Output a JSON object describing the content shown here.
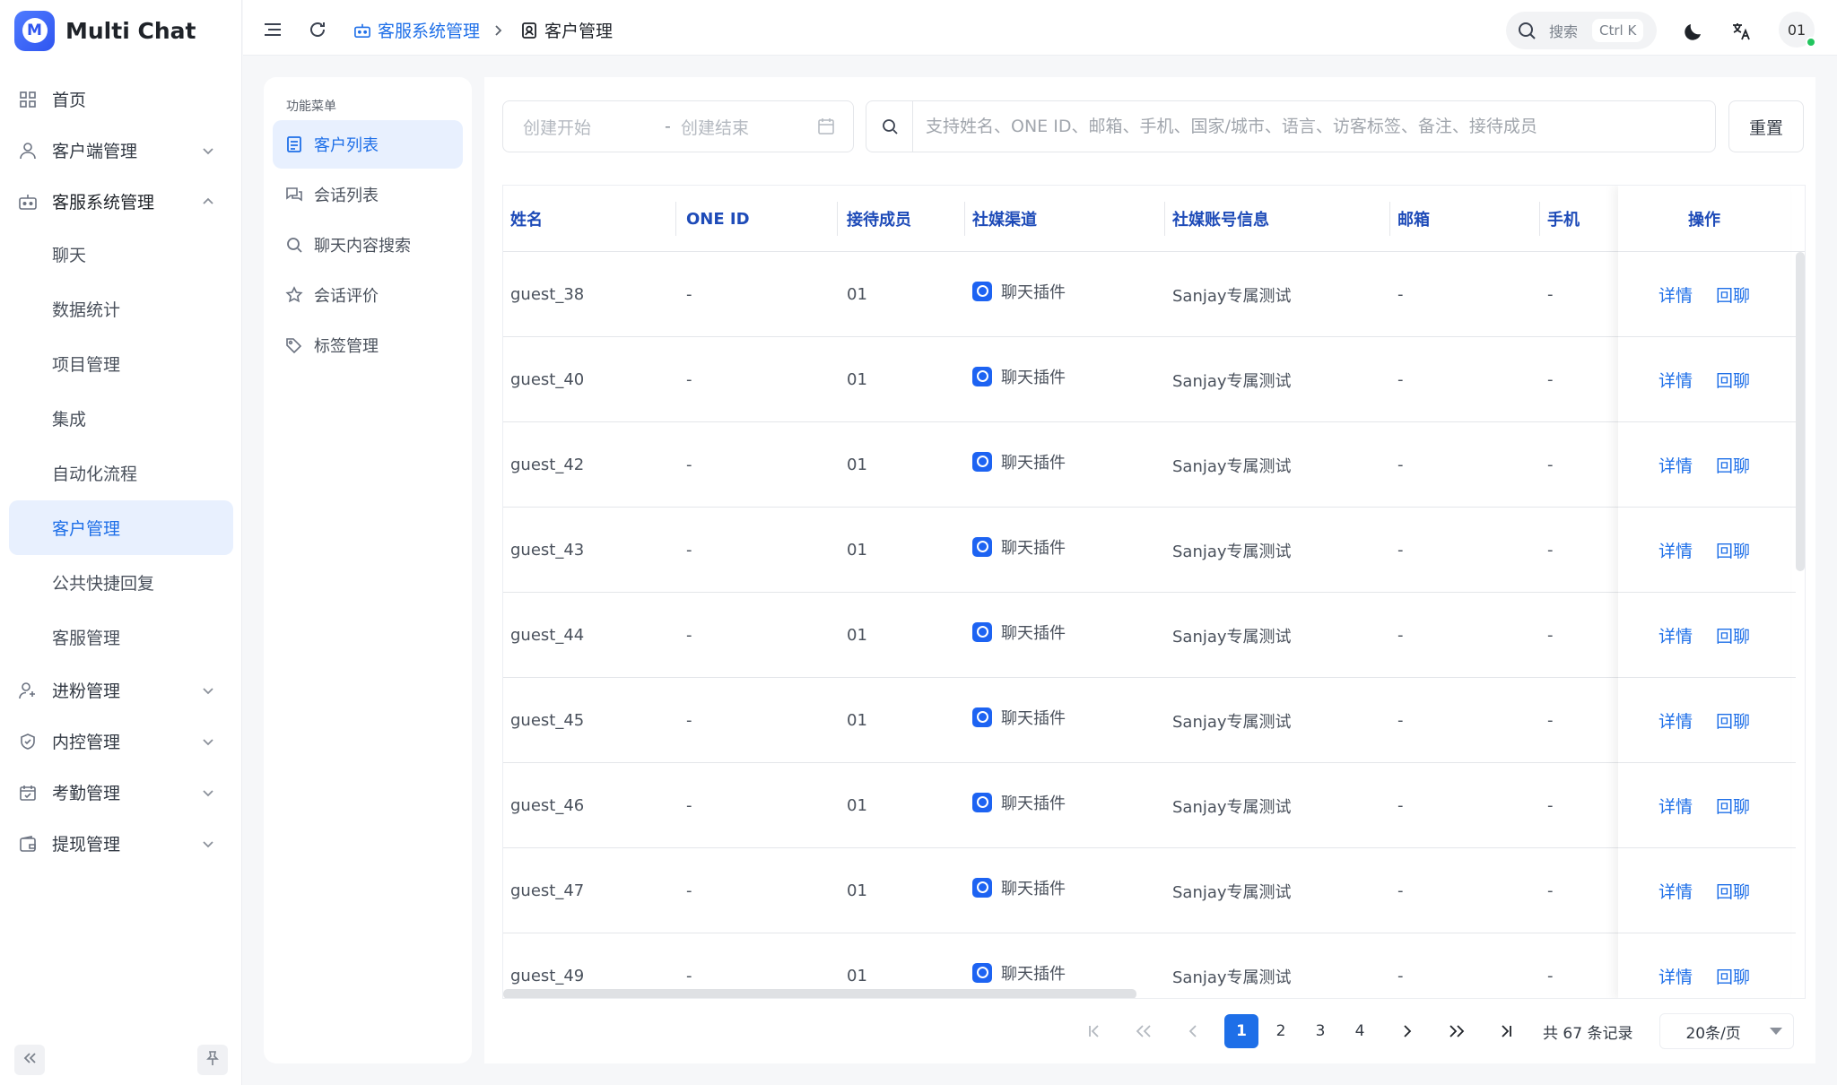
{
  "brand": {
    "logo": "M",
    "name": "Multi Chat"
  },
  "sidebar": {
    "items": [
      {
        "label": "首页",
        "icon": "dashboard-icon"
      },
      {
        "label": "客户端管理",
        "icon": "user-icon"
      },
      {
        "label": "客服系统管理",
        "icon": "robot-icon"
      },
      {
        "label": "进粉管理",
        "icon": "user-plus-icon"
      },
      {
        "label": "内控管理",
        "icon": "shield-icon"
      },
      {
        "label": "考勤管理",
        "icon": "calendar-check-icon"
      },
      {
        "label": "提现管理",
        "icon": "wallet-icon"
      }
    ],
    "sub_items": [
      "聊天",
      "数据统计",
      "项目管理",
      "集成",
      "自动化流程",
      "客户管理",
      "公共快捷回复",
      "客服管理"
    ],
    "active_sub": "客户管理"
  },
  "header": {
    "breadcrumb": {
      "parent": "客服系统管理",
      "current": "客户管理"
    },
    "search_label": "搜索",
    "search_shortcut": "Ctrl K",
    "avatar": "01"
  },
  "func_menu": {
    "title": "功能菜单",
    "items": [
      {
        "label": "客户列表",
        "icon": "document-list-icon"
      },
      {
        "label": "会话列表",
        "icon": "chat-bubbles-icon"
      },
      {
        "label": "聊天内容搜索",
        "icon": "search-icon"
      },
      {
        "label": "会话评价",
        "icon": "star-icon"
      },
      {
        "label": "标签管理",
        "icon": "tag-icon"
      }
    ]
  },
  "filters": {
    "date_start_placeholder": "创建开始",
    "date_separator": "-",
    "date_end_placeholder": "创建结束",
    "search_placeholder": "支持姓名、ONE ID、邮箱、手机、国家/城市、语言、访客标签、备注、接待成员",
    "reset_label": "重置"
  },
  "table": {
    "columns": [
      "姓名",
      "ONE ID",
      "接待成员",
      "社媒渠道",
      "社媒账号信息",
      "邮箱",
      "手机",
      "操作"
    ],
    "rows": [
      {
        "name": "guest_38",
        "one_id": "-",
        "member": "01",
        "channel": "聊天插件",
        "account": "Sanjay专属测试",
        "email": "-",
        "phone": "-"
      },
      {
        "name": "guest_40",
        "one_id": "-",
        "member": "01",
        "channel": "聊天插件",
        "account": "Sanjay专属测试",
        "email": "-",
        "phone": "-"
      },
      {
        "name": "guest_42",
        "one_id": "-",
        "member": "01",
        "channel": "聊天插件",
        "account": "Sanjay专属测试",
        "email": "-",
        "phone": "-"
      },
      {
        "name": "guest_43",
        "one_id": "-",
        "member": "01",
        "channel": "聊天插件",
        "account": "Sanjay专属测试",
        "email": "-",
        "phone": "-"
      },
      {
        "name": "guest_44",
        "one_id": "-",
        "member": "01",
        "channel": "聊天插件",
        "account": "Sanjay专属测试",
        "email": "-",
        "phone": "-"
      },
      {
        "name": "guest_45",
        "one_id": "-",
        "member": "01",
        "channel": "聊天插件",
        "account": "Sanjay专属测试",
        "email": "-",
        "phone": "-"
      },
      {
        "name": "guest_46",
        "one_id": "-",
        "member": "01",
        "channel": "聊天插件",
        "account": "Sanjay专属测试",
        "email": "-",
        "phone": "-"
      },
      {
        "name": "guest_47",
        "one_id": "-",
        "member": "01",
        "channel": "聊天插件",
        "account": "Sanjay专属测试",
        "email": "-",
        "phone": "-"
      },
      {
        "name": "guest_49",
        "one_id": "-",
        "member": "01",
        "channel": "聊天插件",
        "account": "Sanjay专属测试",
        "email": "-",
        "phone": "-"
      }
    ],
    "action_detail": "详情",
    "action_reply": "回聊"
  },
  "pagination": {
    "pages": [
      "1",
      "2",
      "3",
      "4"
    ],
    "current": "1",
    "total_text": "共 67 条记录",
    "page_size": "20条/页"
  },
  "colors": {
    "accent": "#1e6fe8",
    "active_bg": "#e8f0fe",
    "header_text": "#1e4bb8",
    "online": "#22c55e"
  }
}
